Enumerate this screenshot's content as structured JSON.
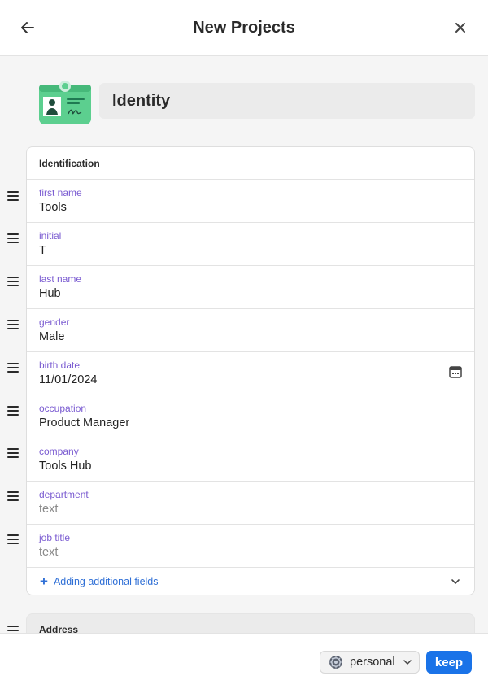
{
  "header": {
    "title": "New Projects",
    "back_icon": "arrow-left-icon",
    "close_icon": "close-icon"
  },
  "item": {
    "type_icon": "id-card-icon",
    "title": "Identity"
  },
  "identification": {
    "heading": "Identification",
    "fields": [
      {
        "label": "first name",
        "value": "Tools"
      },
      {
        "label": "initial",
        "value": "T"
      },
      {
        "label": "last name",
        "value": "Hub"
      },
      {
        "label": "gender",
        "value": "Male"
      },
      {
        "label": "birth date",
        "value": "11/01/2024"
      },
      {
        "label": "occupation",
        "value": "Product Manager"
      },
      {
        "label": "company",
        "value": "Tools Hub"
      },
      {
        "label": "department",
        "value": "text"
      },
      {
        "label": "job title",
        "value": "text"
      }
    ],
    "add_fields_label": "Adding additional fields"
  },
  "address": {
    "heading": "Address"
  },
  "footer": {
    "vault_label": "personal",
    "vault_icon": "vault-icon",
    "keep_label": "keep"
  },
  "colors": {
    "accent": "#1a73e8",
    "label": "#7a5bd1",
    "id_icon": "#5ccf8f"
  }
}
